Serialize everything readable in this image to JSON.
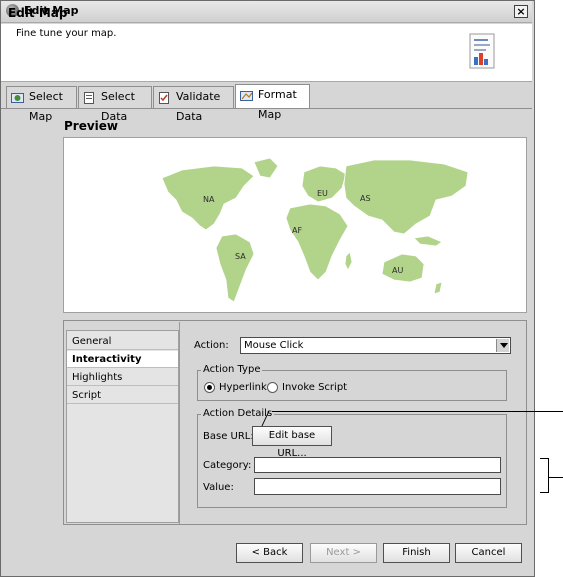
{
  "window": {
    "title": "Edit Map"
  },
  "header": {
    "title": "Edit Map",
    "subtitle": "Fine tune your map."
  },
  "tabs": [
    {
      "label": "Select Map",
      "icon": "select-map-icon"
    },
    {
      "label": "Select Data",
      "icon": "select-data-icon"
    },
    {
      "label": "Validate Data",
      "icon": "validate-data-icon"
    },
    {
      "label": "Format Map",
      "icon": "format-map-icon",
      "active": true
    }
  ],
  "preview": {
    "label": "Preview",
    "continents": [
      "NA",
      "EU",
      "AS",
      "AF",
      "SA",
      "AU"
    ],
    "land_color": "#b2d48a"
  },
  "side_list": [
    "General",
    "Interactivity",
    "Highlights",
    "Script"
  ],
  "action": {
    "label": "Action:",
    "value": "Mouse Click"
  },
  "action_type": {
    "title": "Action Type",
    "options": [
      "Hyperlink",
      "Invoke Script"
    ],
    "selected": "Hyperlink"
  },
  "action_details": {
    "title": "Action Details",
    "base_url_label": "Base URL:",
    "base_url_button": "Edit base URL...",
    "category_label": "Category:",
    "category_value": "",
    "value_label": "Value:",
    "value_value": ""
  },
  "footer": {
    "back": "< Back",
    "next": "Next >",
    "finish": "Finish",
    "cancel": "Cancel"
  }
}
